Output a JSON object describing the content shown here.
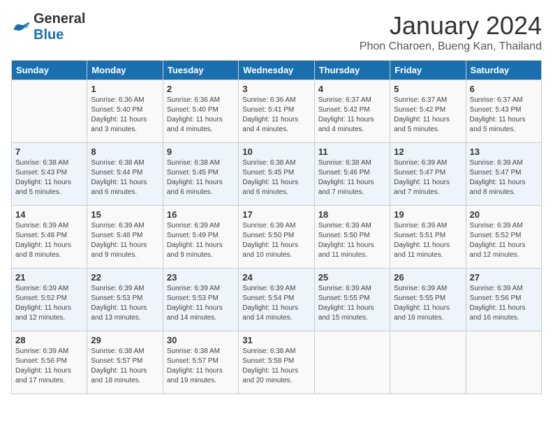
{
  "logo": {
    "general": "General",
    "blue": "Blue"
  },
  "title": "January 2024",
  "location": "Phon Charoen, Bueng Kan, Thailand",
  "headers": [
    "Sunday",
    "Monday",
    "Tuesday",
    "Wednesday",
    "Thursday",
    "Friday",
    "Saturday"
  ],
  "weeks": [
    [
      {
        "day": "",
        "info": ""
      },
      {
        "day": "1",
        "info": "Sunrise: 6:36 AM\nSunset: 5:40 PM\nDaylight: 11 hours\nand 3 minutes."
      },
      {
        "day": "2",
        "info": "Sunrise: 6:36 AM\nSunset: 5:40 PM\nDaylight: 11 hours\nand 4 minutes."
      },
      {
        "day": "3",
        "info": "Sunrise: 6:36 AM\nSunset: 5:41 PM\nDaylight: 11 hours\nand 4 minutes."
      },
      {
        "day": "4",
        "info": "Sunrise: 6:37 AM\nSunset: 5:42 PM\nDaylight: 11 hours\nand 4 minutes."
      },
      {
        "day": "5",
        "info": "Sunrise: 6:37 AM\nSunset: 5:42 PM\nDaylight: 11 hours\nand 5 minutes."
      },
      {
        "day": "6",
        "info": "Sunrise: 6:37 AM\nSunset: 5:43 PM\nDaylight: 11 hours\nand 5 minutes."
      }
    ],
    [
      {
        "day": "7",
        "info": "Sunrise: 6:38 AM\nSunset: 5:43 PM\nDaylight: 11 hours\nand 5 minutes."
      },
      {
        "day": "8",
        "info": "Sunrise: 6:38 AM\nSunset: 5:44 PM\nDaylight: 11 hours\nand 6 minutes."
      },
      {
        "day": "9",
        "info": "Sunrise: 6:38 AM\nSunset: 5:45 PM\nDaylight: 11 hours\nand 6 minutes."
      },
      {
        "day": "10",
        "info": "Sunrise: 6:38 AM\nSunset: 5:45 PM\nDaylight: 11 hours\nand 6 minutes."
      },
      {
        "day": "11",
        "info": "Sunrise: 6:38 AM\nSunset: 5:46 PM\nDaylight: 11 hours\nand 7 minutes."
      },
      {
        "day": "12",
        "info": "Sunrise: 6:39 AM\nSunset: 5:47 PM\nDaylight: 11 hours\nand 7 minutes."
      },
      {
        "day": "13",
        "info": "Sunrise: 6:39 AM\nSunset: 5:47 PM\nDaylight: 11 hours\nand 8 minutes."
      }
    ],
    [
      {
        "day": "14",
        "info": "Sunrise: 6:39 AM\nSunset: 5:48 PM\nDaylight: 11 hours\nand 8 minutes."
      },
      {
        "day": "15",
        "info": "Sunrise: 6:39 AM\nSunset: 5:48 PM\nDaylight: 11 hours\nand 9 minutes."
      },
      {
        "day": "16",
        "info": "Sunrise: 6:39 AM\nSunset: 5:49 PM\nDaylight: 11 hours\nand 9 minutes."
      },
      {
        "day": "17",
        "info": "Sunrise: 6:39 AM\nSunset: 5:50 PM\nDaylight: 11 hours\nand 10 minutes."
      },
      {
        "day": "18",
        "info": "Sunrise: 6:39 AM\nSunset: 5:50 PM\nDaylight: 11 hours\nand 11 minutes."
      },
      {
        "day": "19",
        "info": "Sunrise: 6:39 AM\nSunset: 5:51 PM\nDaylight: 11 hours\nand 11 minutes."
      },
      {
        "day": "20",
        "info": "Sunrise: 6:39 AM\nSunset: 5:52 PM\nDaylight: 11 hours\nand 12 minutes."
      }
    ],
    [
      {
        "day": "21",
        "info": "Sunrise: 6:39 AM\nSunset: 5:52 PM\nDaylight: 11 hours\nand 12 minutes."
      },
      {
        "day": "22",
        "info": "Sunrise: 6:39 AM\nSunset: 5:53 PM\nDaylight: 11 hours\nand 13 minutes."
      },
      {
        "day": "23",
        "info": "Sunrise: 6:39 AM\nSunset: 5:53 PM\nDaylight: 11 hours\nand 14 minutes."
      },
      {
        "day": "24",
        "info": "Sunrise: 6:39 AM\nSunset: 5:54 PM\nDaylight: 11 hours\nand 14 minutes."
      },
      {
        "day": "25",
        "info": "Sunrise: 6:39 AM\nSunset: 5:55 PM\nDaylight: 11 hours\nand 15 minutes."
      },
      {
        "day": "26",
        "info": "Sunrise: 6:39 AM\nSunset: 5:55 PM\nDaylight: 11 hours\nand 16 minutes."
      },
      {
        "day": "27",
        "info": "Sunrise: 6:39 AM\nSunset: 5:56 PM\nDaylight: 11 hours\nand 16 minutes."
      }
    ],
    [
      {
        "day": "28",
        "info": "Sunrise: 6:39 AM\nSunset: 5:56 PM\nDaylight: 11 hours\nand 17 minutes."
      },
      {
        "day": "29",
        "info": "Sunrise: 6:38 AM\nSunset: 5:57 PM\nDaylight: 11 hours\nand 18 minutes."
      },
      {
        "day": "30",
        "info": "Sunrise: 6:38 AM\nSunset: 5:57 PM\nDaylight: 11 hours\nand 19 minutes."
      },
      {
        "day": "31",
        "info": "Sunrise: 6:38 AM\nSunset: 5:58 PM\nDaylight: 11 hours\nand 20 minutes."
      },
      {
        "day": "",
        "info": ""
      },
      {
        "day": "",
        "info": ""
      },
      {
        "day": "",
        "info": ""
      }
    ]
  ]
}
